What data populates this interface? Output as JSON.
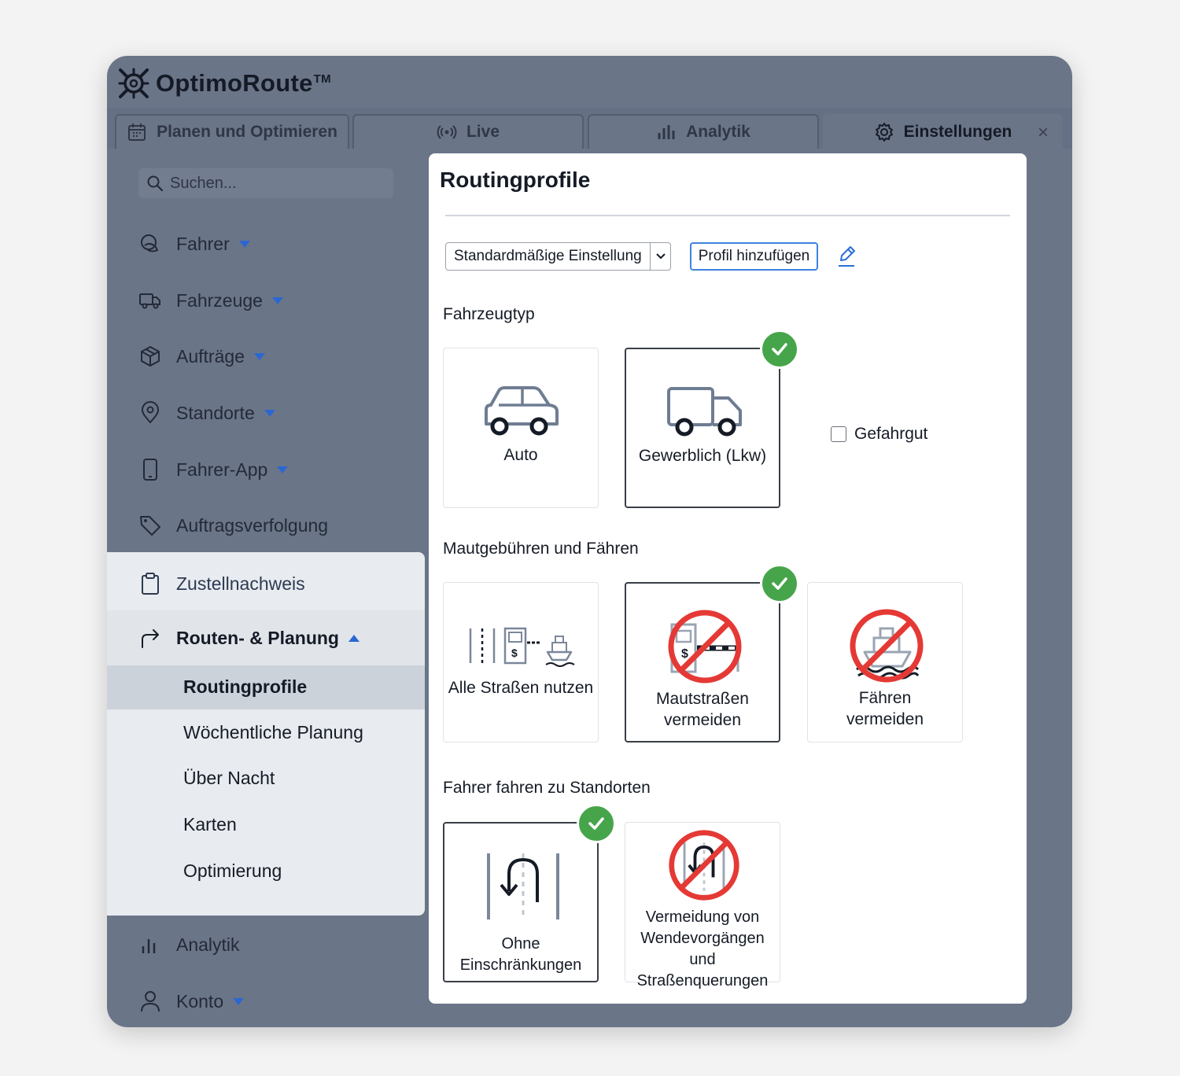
{
  "brand": {
    "name": "OptimoRoute",
    "tm": "TM"
  },
  "tabs": [
    {
      "label": "Planen und Optimieren",
      "icon": "calendar-icon"
    },
    {
      "label": "Live",
      "icon": "broadcast-icon"
    },
    {
      "label": "Analytik",
      "icon": "bar-chart-icon"
    },
    {
      "label": "Einstellungen",
      "icon": "gear-icon",
      "active": true
    }
  ],
  "tab_close": "×",
  "sidebar": {
    "search_placeholder": "Suchen...",
    "items": [
      {
        "label": "Fahrer",
        "icon": "driver-icon",
        "expandable": true
      },
      {
        "label": "Fahrzeuge",
        "icon": "truck-icon",
        "expandable": true
      },
      {
        "label": "Aufträge",
        "icon": "package-icon",
        "expandable": true
      },
      {
        "label": "Standorte",
        "icon": "location-pin-icon",
        "expandable": true
      },
      {
        "label": "Fahrer-App",
        "icon": "phone-icon",
        "expandable": true
      },
      {
        "label": "Auftragsverfolgung",
        "icon": "tag-icon",
        "expandable": false
      },
      {
        "label": "Zustellnachweis",
        "icon": "clipboard-icon",
        "expandable": false
      },
      {
        "label": "Routen- & Planung",
        "icon": "route-arrow-icon",
        "expandable": true,
        "expanded": true
      },
      {
        "label": "Analytik",
        "icon": "bar-chart-icon",
        "expandable": false
      },
      {
        "label": "Konto",
        "icon": "user-icon",
        "expandable": true
      }
    ],
    "sub_items": [
      "Routingprofile",
      "Wöchentliche Planung",
      "Über Nacht",
      "Karten",
      "Optimierung"
    ],
    "active_sub_item": "Routingprofile"
  },
  "main": {
    "title": "Routingprofile",
    "profile_select": "Standardmäßige Einstellung",
    "add_profile_label": "Profil hinzufügen",
    "vehicle_section": {
      "label": "Fahrzeugtyp",
      "options": [
        {
          "label": "Auto",
          "selected": false
        },
        {
          "label": "Gewerblich (Lkw)",
          "selected": true
        }
      ],
      "hazmat_label": "Gefahrgut",
      "hazmat_checked": false
    },
    "toll_section": {
      "label": "Mautgebühren und Fähren",
      "options": [
        {
          "label": "Alle Straßen nutzen",
          "selected": false
        },
        {
          "label_line1": "Mautstraßen",
          "label_line2": "vermeiden",
          "selected": true
        },
        {
          "label_line1": "Fähren",
          "label_line2": "vermeiden",
          "selected": false
        }
      ]
    },
    "driver_section": {
      "label": "Fahrer fahren zu Standorten",
      "options": [
        {
          "label": "Ohne Einschränkungen",
          "selected": true
        },
        {
          "label_line1": "Vermeidung von",
          "label_line2": "Wendevorgängen und",
          "label_line3": "Straßenquerungen",
          "selected": false
        }
      ]
    }
  },
  "colors": {
    "accent": "#3c82e0",
    "check_green": "#46a54a",
    "forbid_red": "#e53935",
    "sidebar_bg": "#6b7588"
  }
}
